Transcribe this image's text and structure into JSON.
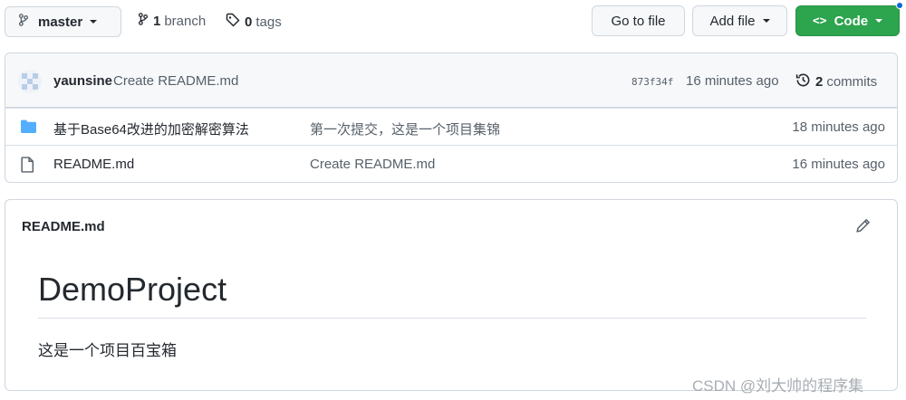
{
  "toolbar": {
    "branch_label": "master",
    "branch_count": "1",
    "branch_word": "branch",
    "tags_count": "0",
    "tags_word": "tags",
    "goto_label": "Go to file",
    "addfile_label": "Add file",
    "code_label": "Code"
  },
  "commit": {
    "author": "yaunsine",
    "message": "Create README.md",
    "sha": "873f34f",
    "time": "16 minutes ago",
    "commits_count": "2",
    "commits_word": "commits"
  },
  "files": [
    {
      "name": "基于Base64改进的加密解密算法",
      "message": "第一次提交，这是一个项目集锦",
      "time": "18 minutes ago",
      "icon": "folder-icon"
    },
    {
      "name": "README.md",
      "message": "Create README.md",
      "time": "16 minutes ago",
      "icon": "file-icon"
    }
  ],
  "readme": {
    "filename": "README.md",
    "title": "DemoProject",
    "body": "这是一个项目百宝箱"
  },
  "watermark": "CSDN @刘大帅的程序集",
  "colors": {
    "accent": "#2da44e",
    "link": "#0969da",
    "folder": "#54aeff"
  }
}
